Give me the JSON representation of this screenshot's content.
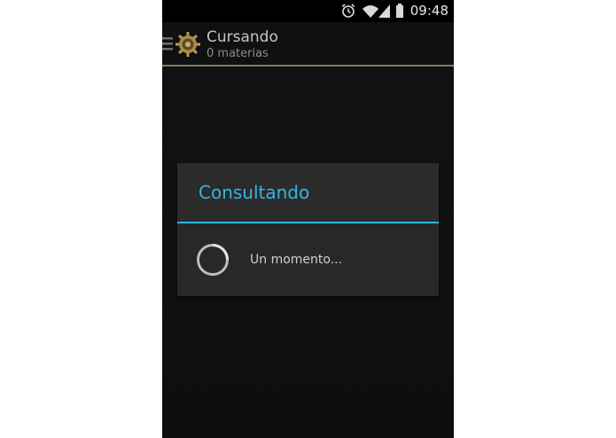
{
  "status_bar": {
    "time": "09:48",
    "icons": [
      "alarm-icon",
      "wifi-icon",
      "signal-icon",
      "battery-icon"
    ]
  },
  "action_bar": {
    "title": "Cursando",
    "subtitle": "0 materias",
    "logo": "gear-logo-icon",
    "nav_icon": "drawer-indicator-icon"
  },
  "dialog": {
    "title": "Consultando",
    "message": "Un momento..."
  },
  "colors": {
    "accent": "#33b5e5",
    "action_bar_divider": "#8a7a52",
    "background": "#111214",
    "dialog_background": "#2a2a2a"
  }
}
